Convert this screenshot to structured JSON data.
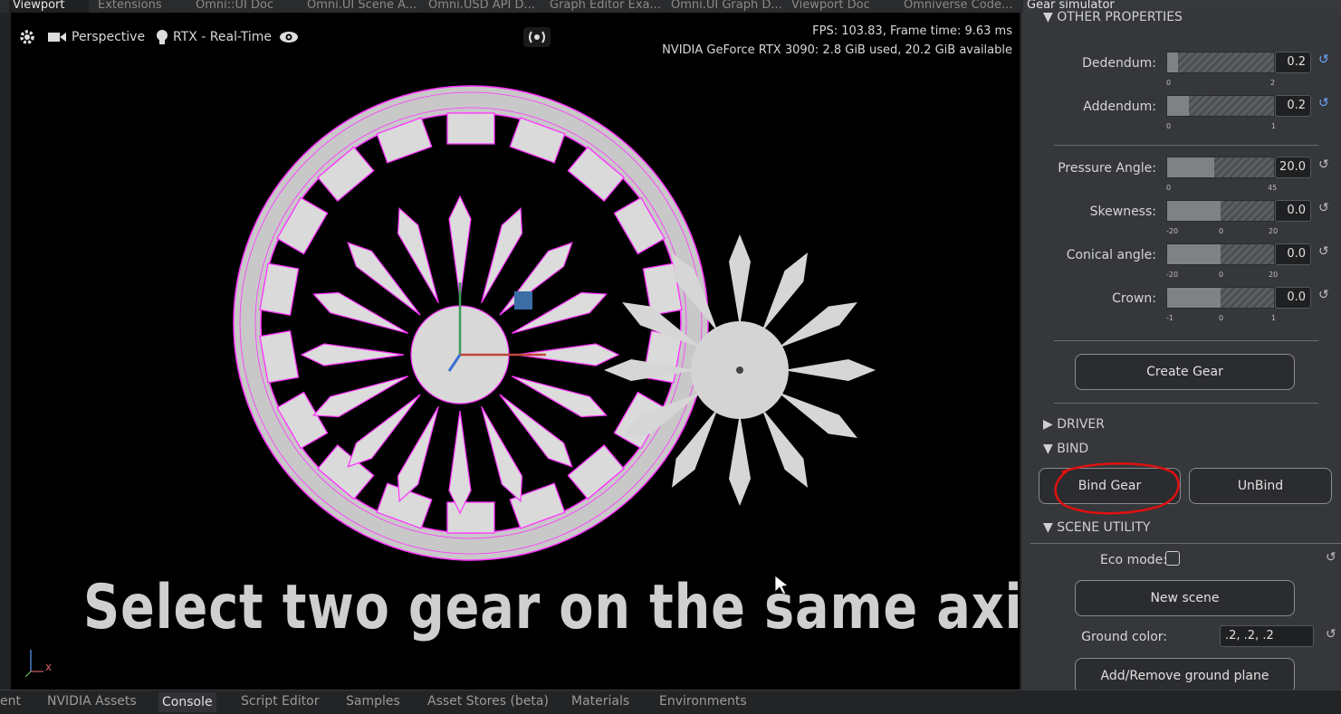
{
  "top_tabs": [
    "Viewport",
    "Extensions",
    "Omni::UI Doc",
    "Omni.UI Scene A...",
    "Omni.USD API D...",
    "Graph Editor Exa...",
    "Omni.UI Graph D...",
    "Viewport Doc",
    "Omniverse Code...",
    "Gear simulator"
  ],
  "viewport": {
    "camera": "Perspective",
    "renderer": "RTX - Real-Time",
    "fps_line": "FPS: 103.83, Frame time: 9.63 ms",
    "gpu_line": "NVIDIA GeForce RTX 3090: 2.8 GiB used,  20.2 GiB available",
    "caption": "Select two gear on the same axis",
    "axis_x": "x"
  },
  "panel": {
    "section_other": "OTHER PROPERTIES",
    "dedendum": {
      "label": "Dedendum:",
      "value": "0.2",
      "min": "0",
      "max": "2",
      "fraction": 0.1
    },
    "addendum": {
      "label": "Addendum:",
      "value": "0.2",
      "min": "0",
      "max": "1",
      "fraction": 0.2
    },
    "pressure_angle": {
      "label": "Pressure Angle:",
      "value": "20.0",
      "min": "0",
      "max": "45",
      "fraction": 0.44
    },
    "skewness": {
      "label": "Skewness:",
      "value": "0.0",
      "min": "-20",
      "mid": "0",
      "max": "20",
      "fraction": 0.5
    },
    "conical_angle": {
      "label": "Conical angle:",
      "value": "0.0",
      "min": "-20",
      "mid": "0",
      "max": "20",
      "fraction": 0.5
    },
    "crown": {
      "label": "Crown:",
      "value": "0.0",
      "min": "-1",
      "mid": "0",
      "max": "1",
      "fraction": 0.5
    },
    "create_gear": "Create Gear",
    "section_driver": "DRIVER",
    "section_bind": "BIND",
    "bind_gear": "Bind Gear",
    "unbind": "UnBind",
    "section_scene": "SCENE UTILITY",
    "eco_mode": "Eco mode:",
    "new_scene": "New scene",
    "ground_color_label": "Ground color:",
    "ground_color_value": ".2, .2, .2",
    "add_remove_ground": "Add/Remove ground plane"
  },
  "bottom_tabs": [
    "ent",
    "NVIDIA Assets",
    "Console",
    "Script Editor",
    "Samples",
    "Asset Stores (beta)",
    "Materials",
    "Environments"
  ],
  "colors": {
    "accent": "#ff00ff",
    "annotation": "#e01010"
  }
}
